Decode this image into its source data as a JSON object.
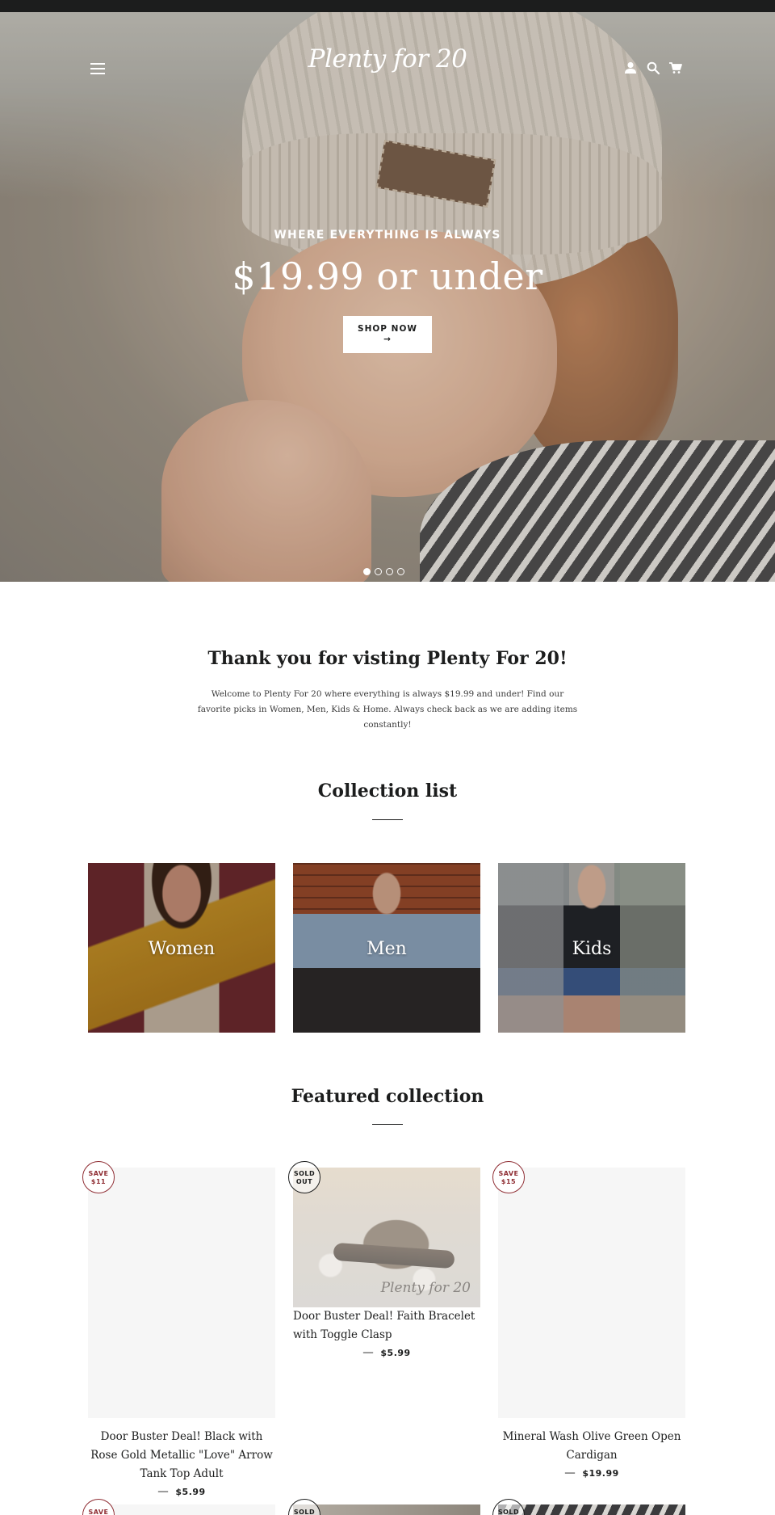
{
  "header": {
    "logo_text": "Plenty for 20",
    "menu_icon": "hamburger-menu-icon",
    "account_icon": "user-icon",
    "search_icon": "search-icon",
    "cart_icon": "cart-icon"
  },
  "hero": {
    "tagline": "WHERE EVERYTHING IS ALWAYS",
    "headline": "$19.99 or under",
    "cta_label": "SHOP NOW",
    "cta_arrow": "→",
    "slides": 4,
    "active_slide": 1
  },
  "welcome": {
    "title": "Thank you for visting Plenty For 20!",
    "body": "Welcome to Plenty For 20 where everything is always $19.99 and under!  Find our favorite picks in Women, Men, Kids & Home. Always check back as we are adding items constantly!"
  },
  "collection_list": {
    "title": "Collection list",
    "items": [
      {
        "label": "Women"
      },
      {
        "label": "Men"
      },
      {
        "label": "Kids"
      }
    ]
  },
  "featured": {
    "title": "Featured collection",
    "products": [
      {
        "badge_line1": "SAVE",
        "badge_line2": "$11",
        "title": "Door Buster Deal! Black with Rose Gold Metallic \"Love\" Arrow Tank Top Adult",
        "separator": "—",
        "price": "$5.99"
      },
      {
        "badge_line1": "SOLD",
        "badge_line2": "OUT",
        "title": "Door Buster Deal! Faith Bracelet with Toggle Clasp",
        "separator": "—",
        "price": "$5.99",
        "image_watermark": "Plenty for 20"
      },
      {
        "badge_line1": "SAVE",
        "badge_line2": "$15",
        "title": "Mineral Wash Olive Green Open Cardigan",
        "separator": "—",
        "price": "$19.99"
      }
    ],
    "next_row_badges": [
      {
        "line1": "SAVE"
      },
      {
        "line1": "SOLD"
      },
      {
        "line1": "SOLD"
      }
    ]
  },
  "colors": {
    "accent_badge": "#8f2d33",
    "text": "#1c1d1d",
    "placeholder_bg": "#f6f6f6"
  }
}
